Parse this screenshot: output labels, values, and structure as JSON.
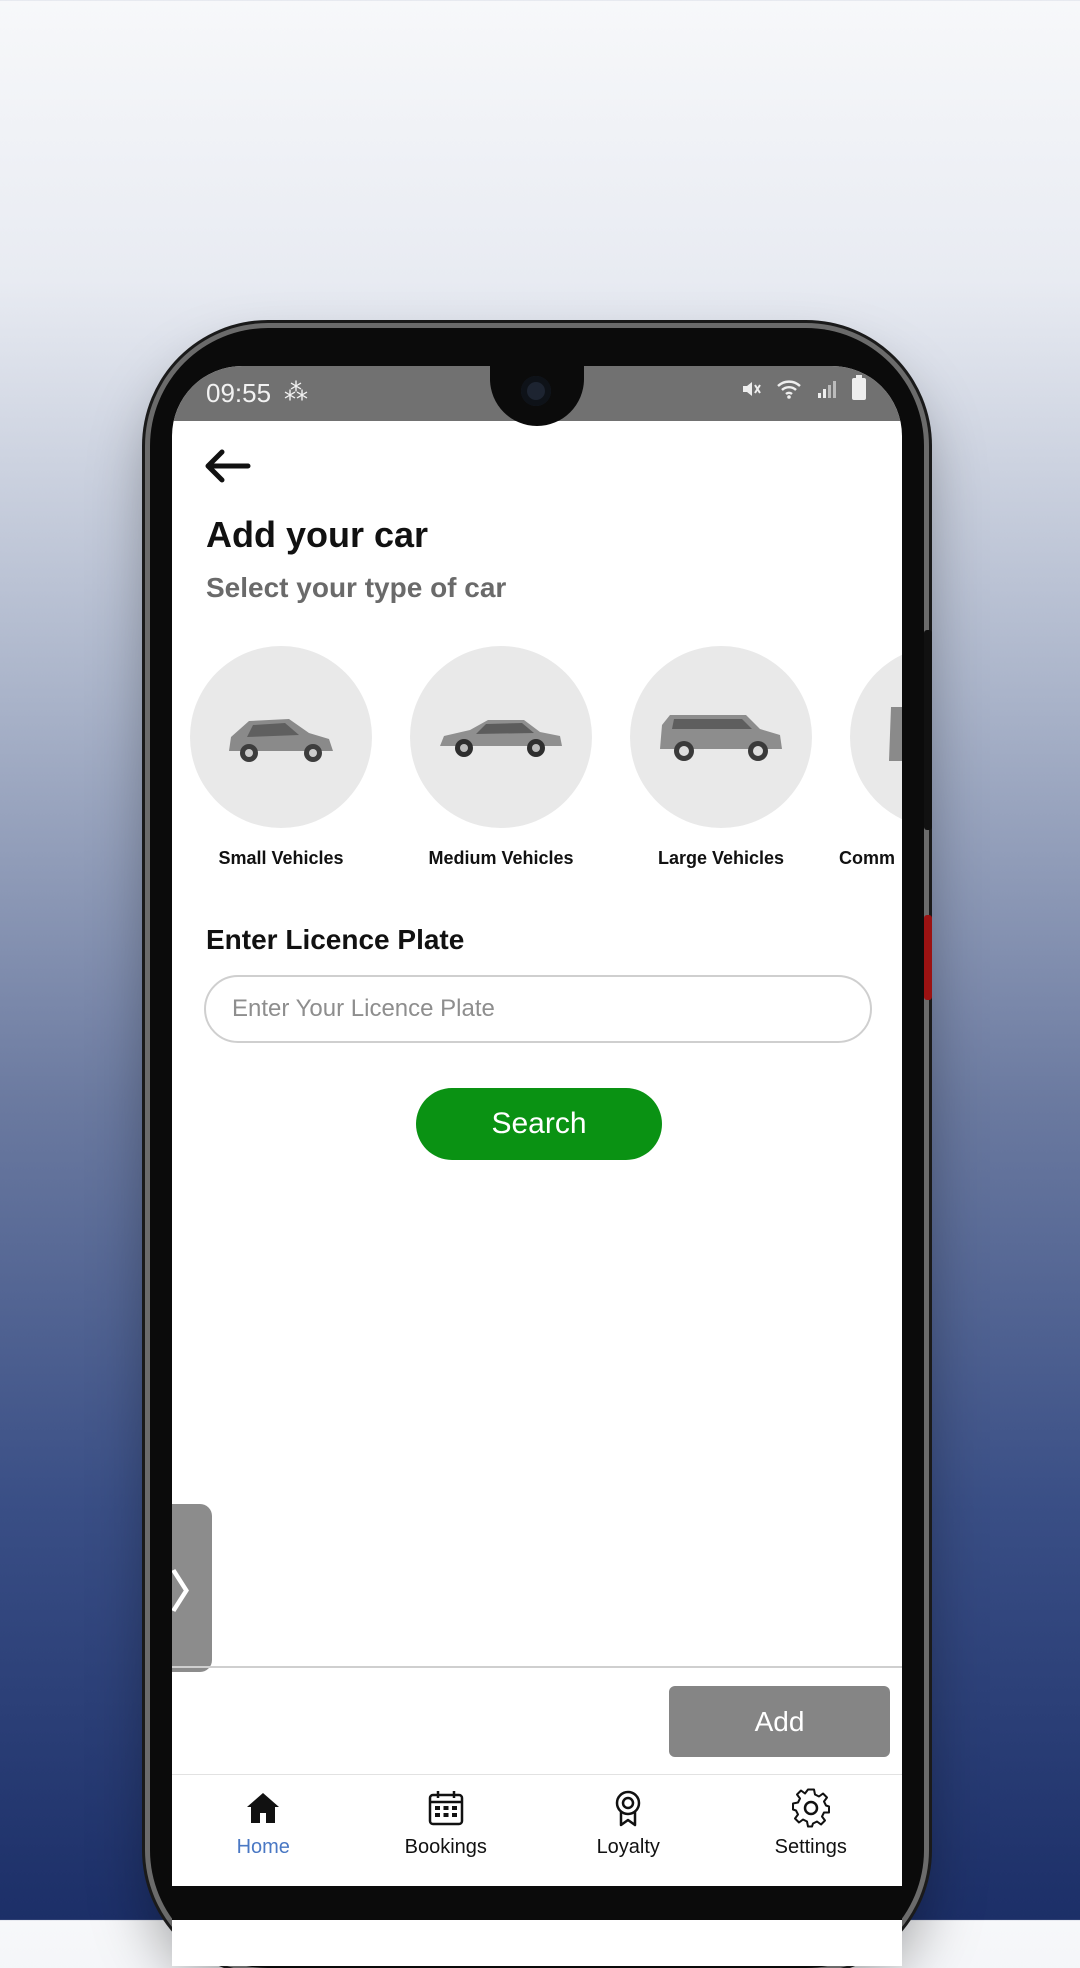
{
  "status_bar": {
    "time": "09:55"
  },
  "header": {
    "title": "Add your car",
    "subtitle": "Select your type of car"
  },
  "vehicle_types": [
    {
      "label": "Small Vehicles"
    },
    {
      "label": "Medium Vehicles"
    },
    {
      "label": "Large Vehicles"
    },
    {
      "label": "Comm"
    }
  ],
  "plate": {
    "label": "Enter Licence Plate",
    "placeholder": "Enter Your Licence Plate"
  },
  "search_button": "Search",
  "add_button": "Add",
  "bottom_nav": [
    {
      "label": "Home",
      "icon": "home-icon",
      "active": true
    },
    {
      "label": "Bookings",
      "icon": "calendar-icon",
      "active": false
    },
    {
      "label": "Loyalty",
      "icon": "award-icon",
      "active": false
    },
    {
      "label": "Settings",
      "icon": "gear-icon",
      "active": false
    }
  ],
  "colors": {
    "accent_green": "#0a9213",
    "active_nav": "#4a78c4",
    "status_bar": "#717171"
  }
}
